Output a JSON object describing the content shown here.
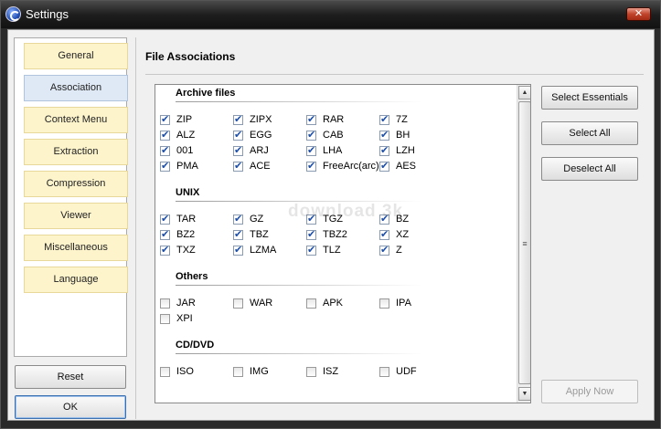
{
  "window": {
    "title": "Settings",
    "close_label": "✕"
  },
  "nav": {
    "items": [
      {
        "label": "General",
        "selected": false
      },
      {
        "label": "Association",
        "selected": true
      },
      {
        "label": "Context Menu",
        "selected": false
      },
      {
        "label": "Extraction",
        "selected": false
      },
      {
        "label": "Compression",
        "selected": false
      },
      {
        "label": "Viewer",
        "selected": false
      },
      {
        "label": "Miscellaneous",
        "selected": false
      },
      {
        "label": "Language",
        "selected": false
      }
    ],
    "reset_label": "Reset",
    "ok_label": "OK"
  },
  "panel": {
    "title": "File Associations",
    "watermark": "download 3k",
    "groups": [
      {
        "title": "Archive files",
        "items": [
          {
            "label": "ZIP",
            "checked": true
          },
          {
            "label": "ZIPX",
            "checked": true
          },
          {
            "label": "RAR",
            "checked": true
          },
          {
            "label": "7Z",
            "checked": true
          },
          {
            "label": "ALZ",
            "checked": true
          },
          {
            "label": "EGG",
            "checked": true
          },
          {
            "label": "CAB",
            "checked": true
          },
          {
            "label": "BH",
            "checked": true
          },
          {
            "label": "001",
            "checked": true
          },
          {
            "label": "ARJ",
            "checked": true
          },
          {
            "label": "LHA",
            "checked": true
          },
          {
            "label": "LZH",
            "checked": true
          },
          {
            "label": "PMA",
            "checked": true
          },
          {
            "label": "ACE",
            "checked": true
          },
          {
            "label": "FreeArc(arc)",
            "checked": true
          },
          {
            "label": "AES",
            "checked": true
          }
        ]
      },
      {
        "title": "UNIX",
        "items": [
          {
            "label": "TAR",
            "checked": true
          },
          {
            "label": "GZ",
            "checked": true
          },
          {
            "label": "TGZ",
            "checked": true
          },
          {
            "label": "BZ",
            "checked": true
          },
          {
            "label": "BZ2",
            "checked": true
          },
          {
            "label": "TBZ",
            "checked": true
          },
          {
            "label": "TBZ2",
            "checked": true
          },
          {
            "label": "XZ",
            "checked": true
          },
          {
            "label": "TXZ",
            "checked": true
          },
          {
            "label": "LZMA",
            "checked": true
          },
          {
            "label": "TLZ",
            "checked": true
          },
          {
            "label": "Z",
            "checked": true
          }
        ]
      },
      {
        "title": "Others",
        "items": [
          {
            "label": "JAR",
            "checked": false
          },
          {
            "label": "WAR",
            "checked": false
          },
          {
            "label": "APK",
            "checked": false
          },
          {
            "label": "IPA",
            "checked": false
          },
          {
            "label": "XPI",
            "checked": false
          }
        ]
      },
      {
        "title": "CD/DVD",
        "items": [
          {
            "label": "ISO",
            "checked": false
          },
          {
            "label": "IMG",
            "checked": false
          },
          {
            "label": "ISZ",
            "checked": false
          },
          {
            "label": "UDF",
            "checked": false
          }
        ]
      }
    ],
    "buttons": {
      "select_essentials": "Select Essentials",
      "select_all": "Select All",
      "deselect_all": "Deselect All",
      "apply_now": "Apply Now"
    }
  }
}
